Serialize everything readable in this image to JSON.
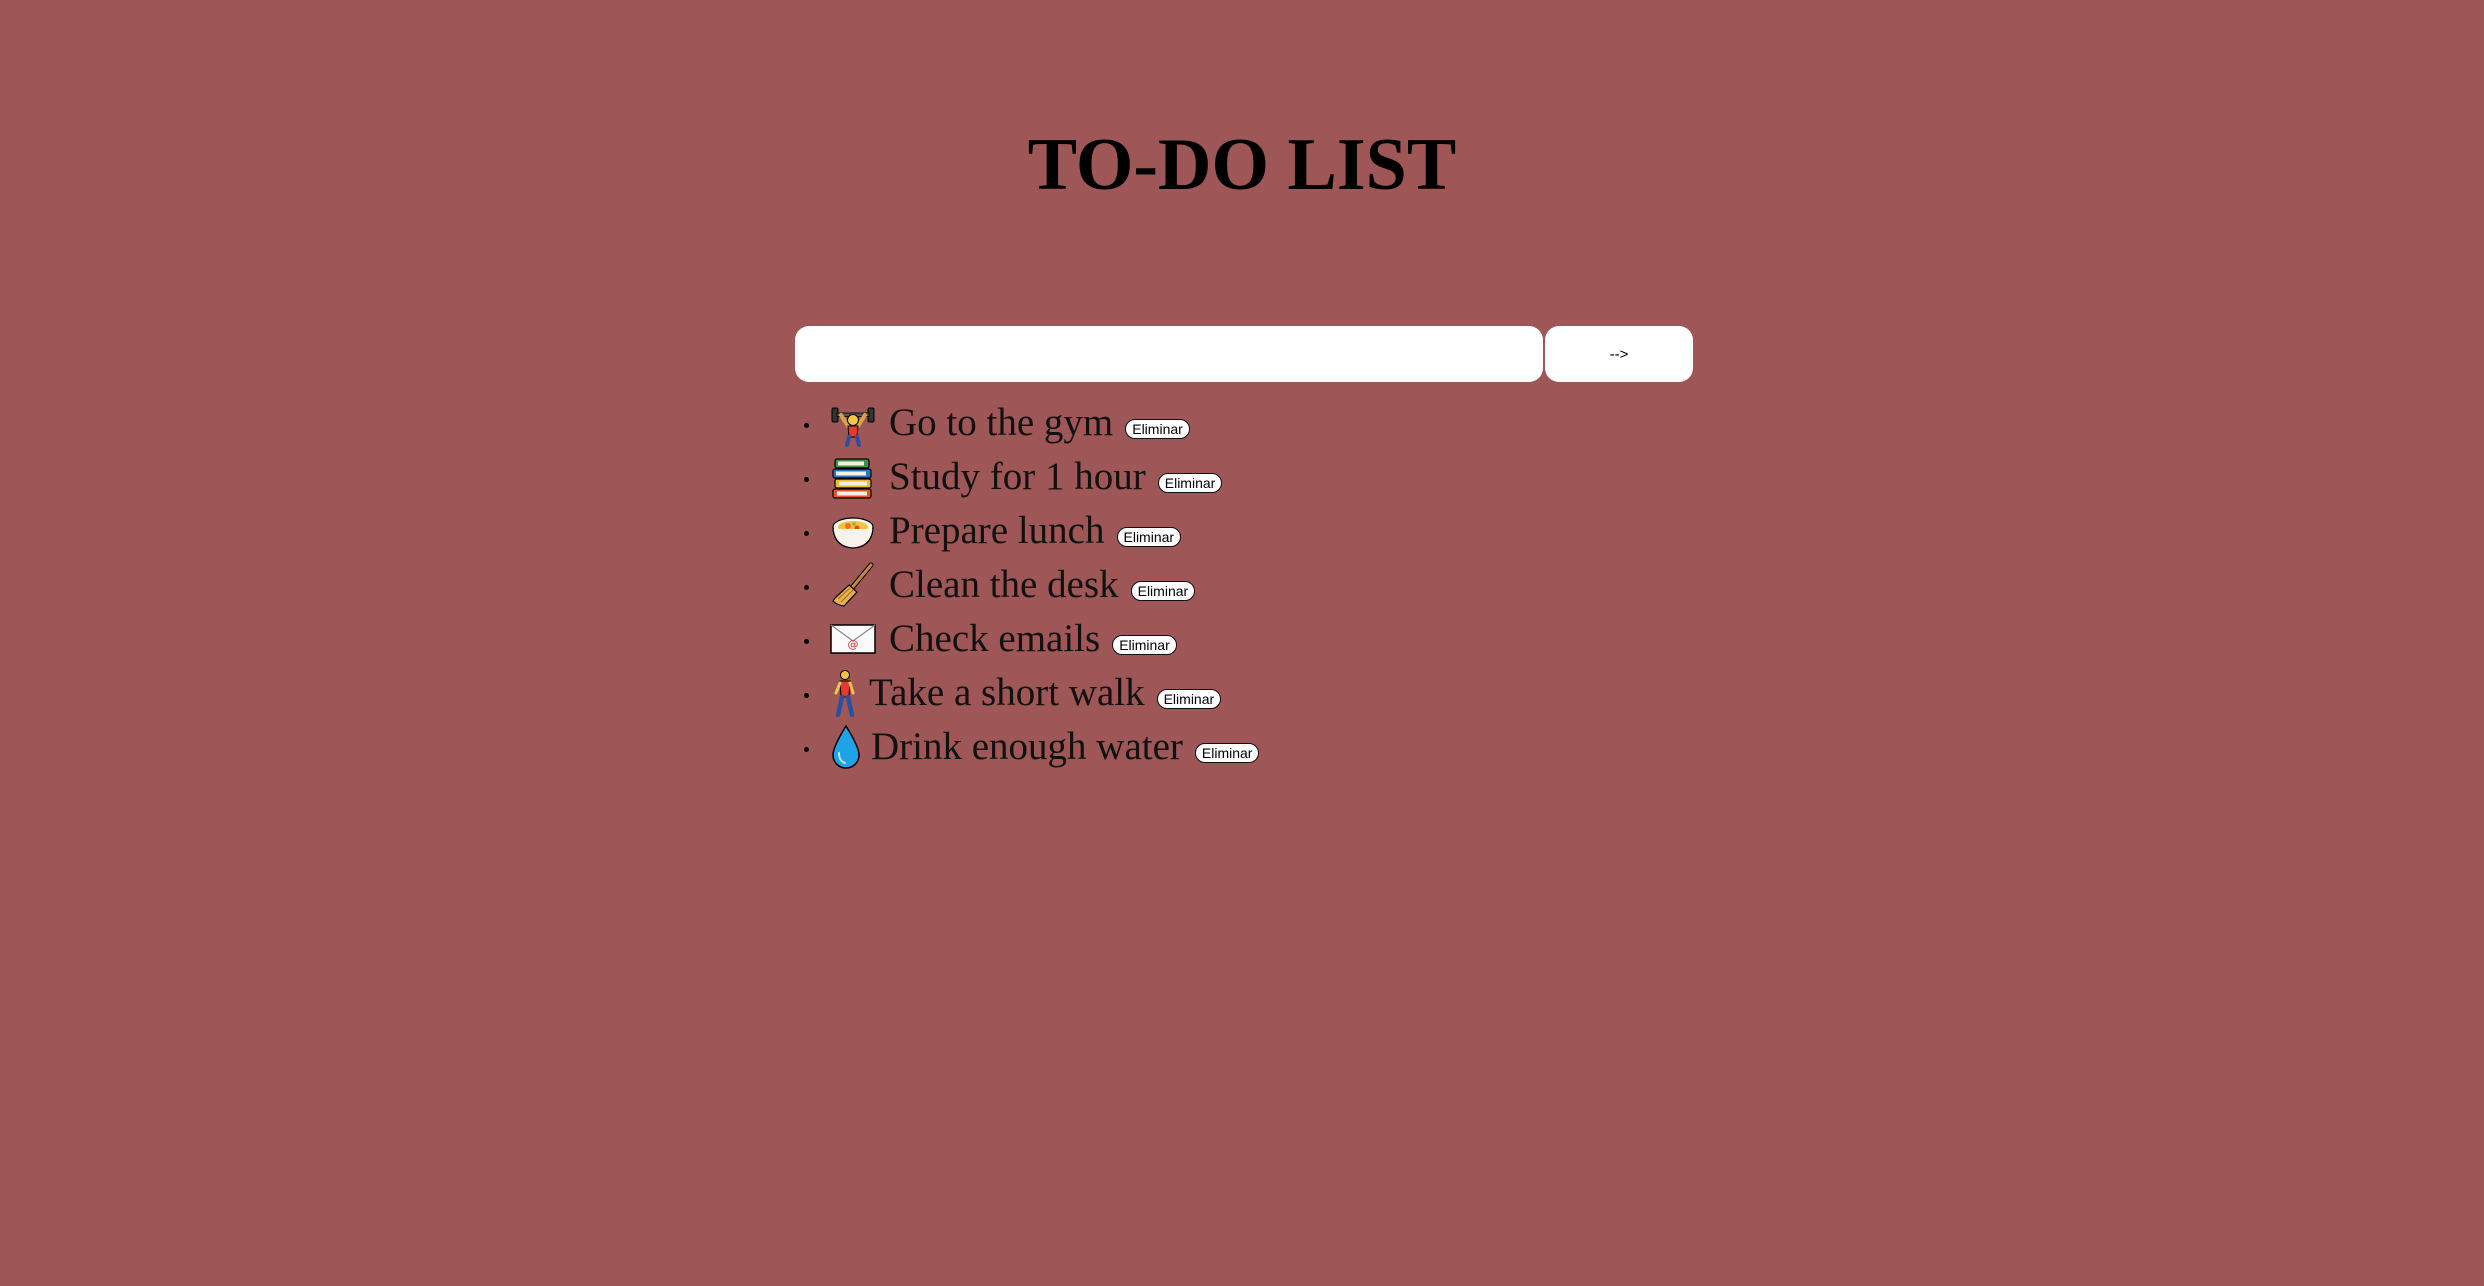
{
  "header": {
    "title": "TO-DO LIST"
  },
  "form": {
    "input_value": "",
    "input_placeholder": "",
    "submit_label": "-->"
  },
  "tasks": [
    {
      "icon": "weightlifter-icon",
      "text": "Go to the gym",
      "delete_label": "Eliminar"
    },
    {
      "icon": "books-icon",
      "text": "Study for 1 hour",
      "delete_label": "Eliminar"
    },
    {
      "icon": "food-bowl-icon",
      "text": "Prepare lunch",
      "delete_label": "Eliminar"
    },
    {
      "icon": "broom-icon",
      "text": "Clean the desk",
      "delete_label": "Eliminar"
    },
    {
      "icon": "email-envelope-icon",
      "text": "Check emails",
      "delete_label": "Eliminar"
    },
    {
      "icon": "walking-person-icon",
      "text": "Take a short walk",
      "delete_label": "Eliminar"
    },
    {
      "icon": "water-drop-icon",
      "text": "Drink enough water",
      "delete_label": "Eliminar"
    }
  ],
  "colors": {
    "background": "#9e5656",
    "input_background": "#ffffff",
    "text": "#111111"
  }
}
